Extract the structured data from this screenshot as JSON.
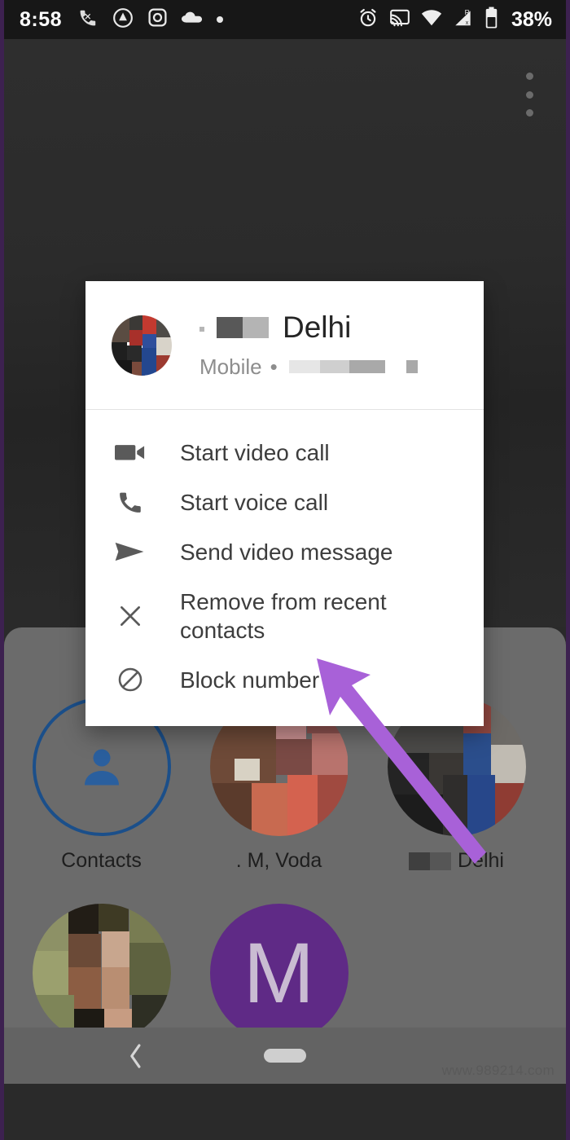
{
  "status_bar": {
    "time": "8:58",
    "battery_percent": "38%",
    "left_icons": [
      "missed-call-icon",
      "adblock-icon",
      "instagram-icon",
      "cloud-icon",
      "dot-icon"
    ],
    "right_icons": [
      "alarm-icon",
      "cast-icon",
      "wifi-icon",
      "cellular-roaming-icon",
      "battery-icon"
    ]
  },
  "app_bar": {
    "overflow_icon": "more-vert-icon"
  },
  "dialog": {
    "contact_name": "Delhi",
    "contact_name_redacted": true,
    "subtitle_label": "Mobile",
    "subtitle_separator": "•",
    "phone_number_redacted": true,
    "avatar": "contact-photo",
    "items": [
      {
        "label": "Start video call",
        "icon": "videocam-icon"
      },
      {
        "label": "Start voice call",
        "icon": "phone-icon"
      },
      {
        "label": "Send video message",
        "icon": "send-icon"
      },
      {
        "label": "Remove from recent contacts",
        "icon": "close-x-icon"
      },
      {
        "label": "Block number",
        "icon": "block-icon"
      }
    ]
  },
  "recents": {
    "rows": [
      [
        {
          "label": "Contacts",
          "avatar_type": "contacts-outline",
          "letter": ""
        },
        {
          "label": ". M, Voda",
          "avatar_type": "photo-warm",
          "letter": ""
        },
        {
          "label": "Delhi",
          "avatar_type": "photo-dark",
          "letter": "",
          "label_redacted": true
        }
      ],
      [
        {
          "label": "",
          "avatar_type": "photo-green",
          "letter": ""
        },
        {
          "label": "",
          "avatar_type": "letter",
          "letter": "M"
        }
      ]
    ]
  },
  "nav_bar": {
    "back_icon": "chevron-left-icon",
    "home_icon": "home-pill-icon"
  },
  "watermark": "www.989214.com",
  "annotation": {
    "type": "arrow",
    "color": "#a861d8",
    "points_to": "Remove from recent contacts"
  },
  "colors": {
    "scrim": "#2b2b2b",
    "panel": "#6b6b6b",
    "dialog_bg": "#ffffff",
    "accent_purple": "#a861d8",
    "contacts_outline": "#1b4f8a",
    "letter_avatar": "#5f2a86"
  }
}
